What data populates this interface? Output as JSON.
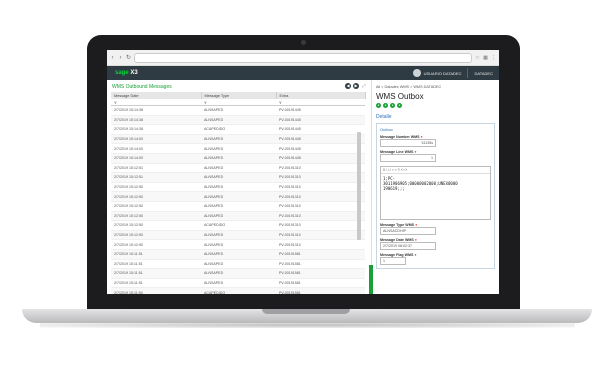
{
  "app": {
    "brand_sage": "sage",
    "brand_x3": "X3",
    "user": "USUARIO DATADEC",
    "folder": "DATADEC"
  },
  "left": {
    "title": "WMS Outbound Messages",
    "columns": [
      "Message Date",
      "Message Type",
      "Extra"
    ],
    "filter": [
      "Y",
      "Y",
      "Y"
    ],
    "rows": [
      [
        "2/7/2019 15:14:38",
        "ALNSAPED",
        "PV-00191445"
      ],
      [
        "2/7/2019 15:14:38",
        "ALNSAPED",
        "PV-00191445"
      ],
      [
        "2/7/2019 15:14:38",
        "ACAPEDIDO",
        "PV-00191445"
      ],
      [
        "2/7/2019 15:14:00",
        "ALNSAPED",
        "PV-00191445"
      ],
      [
        "2/7/2019 15:14:00",
        "ALNSAPED",
        "PV-00191445"
      ],
      [
        "2/7/2019 15:14:00",
        "ALNSAPED",
        "PV-00191445"
      ],
      [
        "2/7/2019 15:12:51",
        "ALNSAPED",
        "PV-00191310"
      ],
      [
        "2/7/2019 15:12:51",
        "ALNSAPED",
        "PV-00191310"
      ],
      [
        "2/7/2019 15:12:50",
        "ALNSAPED",
        "PV-00191310"
      ],
      [
        "2/7/2019 15:12:50",
        "ALNSAPED",
        "PV-00191310"
      ],
      [
        "2/7/2019 15:12:50",
        "ALNSAPED",
        "PV-00191310"
      ],
      [
        "2/7/2019 15:12:50",
        "ALNSAPED",
        "PV-00191310"
      ],
      [
        "2/7/2019 15:12:50",
        "ACAPEDIDO",
        "PV-00191310"
      ],
      [
        "2/7/2019 15:12:50",
        "ALNSAPED",
        "PV-00191310"
      ],
      [
        "2/7/2019 15:12:50",
        "ALNSAPED",
        "PV-00191310"
      ],
      [
        "2/7/2019 15:11:51",
        "ALNSAPED",
        "PV-00191581"
      ],
      [
        "2/7/2019 15:11:51",
        "ALNSAPED",
        "PV-00191581"
      ],
      [
        "2/7/2019 15:11:51",
        "ALNSAPED",
        "PV-00191581"
      ],
      [
        "2/7/2019 15:11:51",
        "ALNSAPED",
        "PV-00191581"
      ],
      [
        "2/7/2019 15:11:50",
        "ACAPEDIDO",
        "PV-00191581"
      ],
      [
        "2/7/2019 15:11:50",
        "ALNSAPED",
        "PV-00191581"
      ],
      [
        "2/7/2019 15:11:50",
        "ALNSAPED",
        "PV-00191581"
      ]
    ]
  },
  "right": {
    "breadcrumb": "All > Datadec WMS > WMS DATADEC",
    "title": "WMS Outbox",
    "section": "Detalle",
    "box_title": "Outbox",
    "fields": {
      "number_label": "Message Number WMS",
      "number_value": "51135s",
      "line_label": "Message Line WMS",
      "line_value": "1",
      "type_label": "Message Type WMS",
      "type_value": "ALNSACDHIP",
      "date_label": "Message Date WMS",
      "date_value": "2/7/2019 08:02:37",
      "flag_label": "Message Flag WMS",
      "flag_value": "1"
    },
    "editor_text": "1;PC-\n3011906905;00000002000;UNEX0000\n190619;;;"
  }
}
